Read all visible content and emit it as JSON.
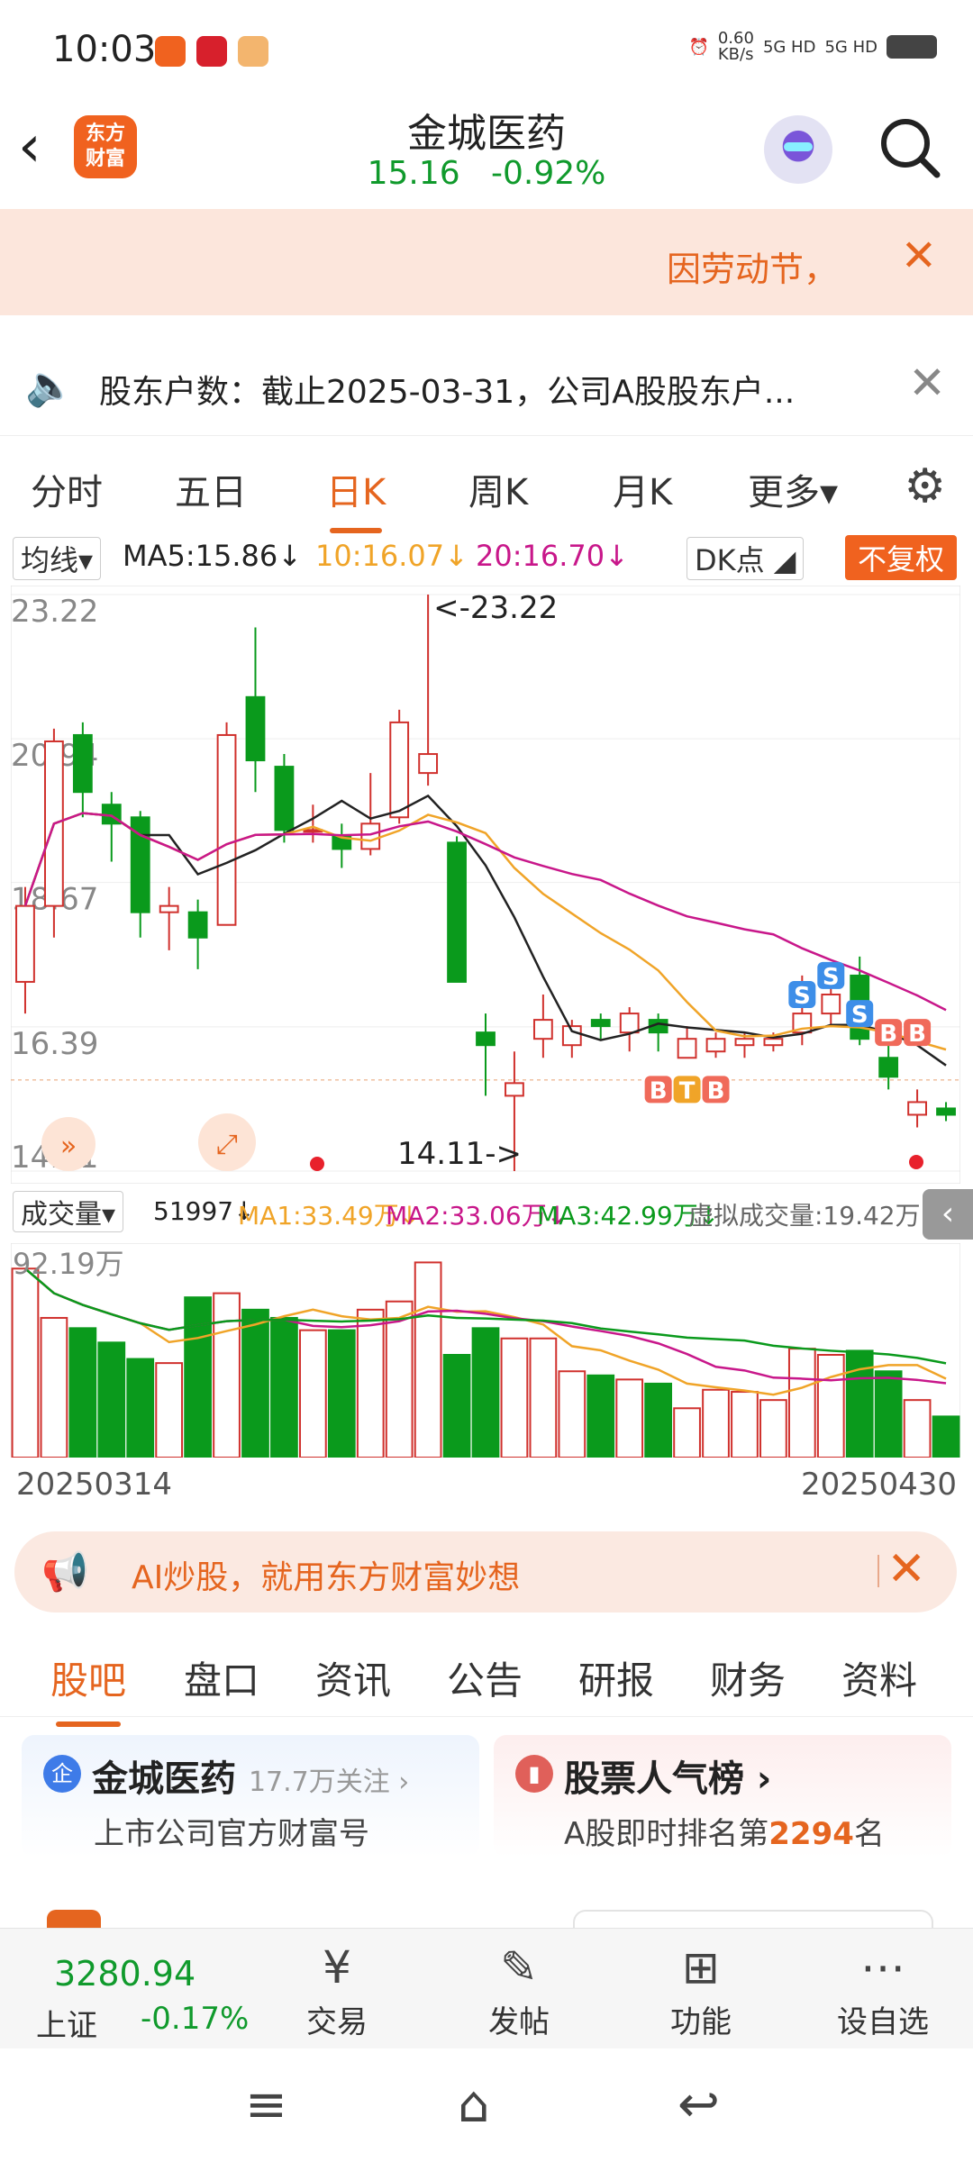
{
  "status": {
    "time": "10:03",
    "net_speed": "0.60\nKB/s",
    "net1": "5G HD",
    "net2": "5G HD"
  },
  "header": {
    "logo": "东方\n财富",
    "name": "金城医药",
    "price": "15.16",
    "change": "-0.92%"
  },
  "notice": {
    "text": "因劳动节，",
    "close": "✕"
  },
  "holders": {
    "text": "股东户数：截止2025-03-31，公司A股股东户...",
    "close": "✕"
  },
  "period_tabs": [
    "分时",
    "五日",
    "日K",
    "周K",
    "月K",
    "更多▾"
  ],
  "ma": {
    "select": "均线▾",
    "ma5": "MA5:15.86↓",
    "ma10": "10:16.07↓",
    "ma20": "20:16.70↓",
    "dk": "DK点 ◢",
    "fq": "不复权"
  },
  "colors": {
    "up": "#d0312d",
    "down": "#0a9a1c",
    "ma5": "#222222",
    "ma10": "#f0a428",
    "ma20": "#c8178a",
    "accent": "#e5651f"
  },
  "chart_data": {
    "type": "candlestick",
    "yticks": [
      "23.22",
      "20.94",
      "18.67",
      "16.39",
      "14.11"
    ],
    "ylim": [
      14.11,
      23.22
    ],
    "max_label": "<-23.22",
    "min_label": "14.11->",
    "candles": [
      [
        17.1,
        18.3,
        18.6,
        16.6
      ],
      [
        18.3,
        20.9,
        21.1,
        17.8
      ],
      [
        21.0,
        20.1,
        21.2,
        19.7
      ],
      [
        19.9,
        19.6,
        20.1,
        19.0
      ],
      [
        19.7,
        18.2,
        19.8,
        17.8
      ],
      [
        18.2,
        18.3,
        18.6,
        17.6
      ],
      [
        18.2,
        17.8,
        18.4,
        17.3
      ],
      [
        18.0,
        21.0,
        21.2,
        18.0
      ],
      [
        21.6,
        20.6,
        22.7,
        20.1
      ],
      [
        20.5,
        19.5,
        20.7,
        19.3
      ],
      [
        19.5,
        19.5,
        19.9,
        19.3
      ],
      [
        19.4,
        19.2,
        19.6,
        18.9
      ],
      [
        19.2,
        19.6,
        20.4,
        19.1
      ],
      [
        19.7,
        21.2,
        21.4,
        19.6
      ],
      [
        20.4,
        20.7,
        23.22,
        20.2
      ],
      [
        19.3,
        17.1,
        19.4,
        17.1
      ],
      [
        16.3,
        16.1,
        16.6,
        15.3
      ],
      [
        15.3,
        15.5,
        16.0,
        14.11
      ],
      [
        16.2,
        16.5,
        16.9,
        15.9
      ],
      [
        16.1,
        16.4,
        16.5,
        15.9
      ],
      [
        16.5,
        16.4,
        16.6,
        16.2
      ],
      [
        16.3,
        16.6,
        16.7,
        16.0
      ],
      [
        16.5,
        16.3,
        16.6,
        16.0
      ],
      [
        15.9,
        16.2,
        16.4,
        15.9
      ],
      [
        16.0,
        16.2,
        16.3,
        15.9
      ],
      [
        16.1,
        16.2,
        16.3,
        15.9
      ],
      [
        16.1,
        16.2,
        16.3,
        16.0
      ],
      [
        16.3,
        16.6,
        17.2,
        16.1
      ],
      [
        16.6,
        16.9,
        17.2,
        16.4
      ],
      [
        17.2,
        16.2,
        17.5,
        16.1
      ],
      [
        15.9,
        15.6,
        16.1,
        15.4
      ],
      [
        15.0,
        15.2,
        15.4,
        14.8
      ],
      [
        15.1,
        15.0,
        15.2,
        14.9
      ]
    ],
    "markers": [
      "S",
      "S",
      "S",
      "B",
      "T",
      "B",
      "B",
      "B"
    ]
  },
  "volume": {
    "select": "成交量▾",
    "cur": "51997↓",
    "ma1": "MA1:33.49万↓",
    "ma2": "MA2:33.06万↓",
    "ma3": "MA3:42.99万↓",
    "virtual": "虚拟成交量:19.42万",
    "ymax_label": "92.19万",
    "bars": [
      92,
      68,
      63,
      56,
      48,
      46,
      78,
      80,
      72,
      68,
      62,
      62,
      72,
      76,
      95,
      50,
      63,
      58,
      58,
      42,
      40,
      38,
      36,
      24,
      33,
      32,
      28,
      53,
      50,
      52,
      42,
      28,
      20
    ],
    "date_start": "20250314",
    "date_end": "20250430"
  },
  "ai_banner": {
    "text": "AI炒股，就用东方财富妙想",
    "close": "✕"
  },
  "content_tabs": [
    "股吧",
    "盘口",
    "资讯",
    "公告",
    "研报",
    "财务",
    "资料"
  ],
  "cards": {
    "company": "金城医药",
    "follow": "17.7万关注 ›",
    "company_sub": "上市公司官方财富号",
    "rank_title": "股票人气榜 ›",
    "rank_prefix": "A股即时排名第",
    "rank_value": "2294",
    "rank_suffix": "名"
  },
  "bottom": {
    "index_val": "3280.94",
    "index_name": "上证",
    "index_chg": "-0.17%",
    "nav": [
      "交易",
      "发帖",
      "功能",
      "设自选"
    ]
  }
}
